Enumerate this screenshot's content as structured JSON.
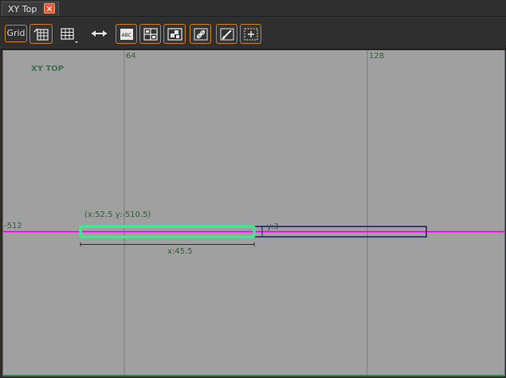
{
  "tab": {
    "title": "XY Top",
    "close_glyph": "✕"
  },
  "toolbar": {
    "grid_label": "Grid",
    "buttons": [
      {
        "name": "grid-settings-button",
        "icon": "grid-settings-icon"
      },
      {
        "name": "grid-dropdown-button",
        "icon": "grid-dropdown-icon"
      },
      {
        "name": "stretch-button",
        "icon": "stretch-horizontal-icon"
      },
      {
        "name": "texture-abc-button",
        "icon": "texture-abc-icon"
      },
      {
        "name": "grid-snap-button",
        "icon": "grid-snap-icon"
      },
      {
        "name": "select-button",
        "icon": "select-icon"
      },
      {
        "name": "link-button",
        "icon": "link-icon"
      },
      {
        "name": "edit-button",
        "icon": "edit-icon"
      },
      {
        "name": "center-button",
        "icon": "center-icon"
      }
    ]
  },
  "viewport": {
    "view_name": "XY TOP",
    "grid_labels": {
      "x1": "64",
      "x2": "128",
      "y1": "-512"
    },
    "selection_coords": "(x:52.5  y:-510.5)",
    "dim_x": "x:45.5",
    "dim_y": "y:3",
    "colors": {
      "background": "#a0a0a0",
      "grid_line": "#7a7a7a",
      "axis_line": "#e000e0",
      "selection": "#40e890",
      "brush": "#1a1a6a",
      "text": "#2e5e3a"
    }
  }
}
